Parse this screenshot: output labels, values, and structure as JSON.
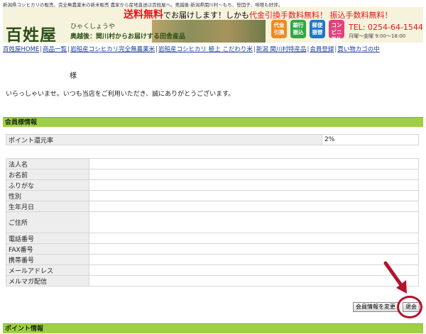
{
  "header": {
    "tagline": "新潟県コシヒカリの販売、完全無農薬米の新米販売 農家から産地直送は百姓屋へ。奥越後:新潟県関川村～もち、笹団子、味噌も好評。",
    "promo_free": "送料無料",
    "promo_text1": "でお届けします！しかも",
    "promo_red": "代金引換手数料無料！ 振込手数料無料！",
    "logo": "百姓屋",
    "logo_reading": "ひゃくしょうや",
    "logo_pref": "奥越後：関川村からお届けする田舎産品",
    "badges": [
      {
        "label": "代金引換",
        "color": "#f08a1c"
      },
      {
        "label": "銀行振込",
        "color": "#2ea845"
      },
      {
        "label": "郵便振替",
        "color": "#1f77c9"
      },
      {
        "label": "コンビニ後払",
        "color": "#e0427d"
      }
    ],
    "tel": "TEL: 0254-64-1544",
    "hours": "月曜～金曜 9:00～18:00"
  },
  "nav": [
    "百姓屋HOME",
    "商品一覧",
    "岩船産コシヒカリ完全無農薬米",
    "岩船産コシヒカリ 極上 こだわり米",
    "新潟 関川村特産品",
    "会員登録",
    "買い物カゴの中"
  ],
  "greeting": {
    "sama": "様",
    "welcome": "いらっしゃいませ。いつも当店をご利用いただき、誠にありがとうございます。"
  },
  "member_section": {
    "title": "会員様情報",
    "point_label": "ポイント還元率",
    "point_value": "2%",
    "fields": [
      {
        "label": "法人名",
        "value": ""
      },
      {
        "label": "お名前",
        "value": ""
      },
      {
        "label": "ふりがな",
        "value": ""
      },
      {
        "label": "性別",
        "value": ""
      },
      {
        "label": "生年月日",
        "value": ""
      },
      {
        "label": "ご住所",
        "value": ""
      },
      {
        "label": "電話番号",
        "value": ""
      },
      {
        "label": "FAX番号",
        "value": ""
      },
      {
        "label": "携帯番号",
        "value": ""
      },
      {
        "label": "メールアドレス",
        "value": ""
      },
      {
        "label": "メルマガ配信",
        "value": ""
      }
    ],
    "edit_button": "会員情報を変更",
    "withdraw_button": "退会"
  },
  "point_section": {
    "title": "ポイント情報"
  },
  "colors": {
    "section_bar": "#9fcf45",
    "annotation": "#b5122d",
    "link": "#1a3ea0"
  }
}
